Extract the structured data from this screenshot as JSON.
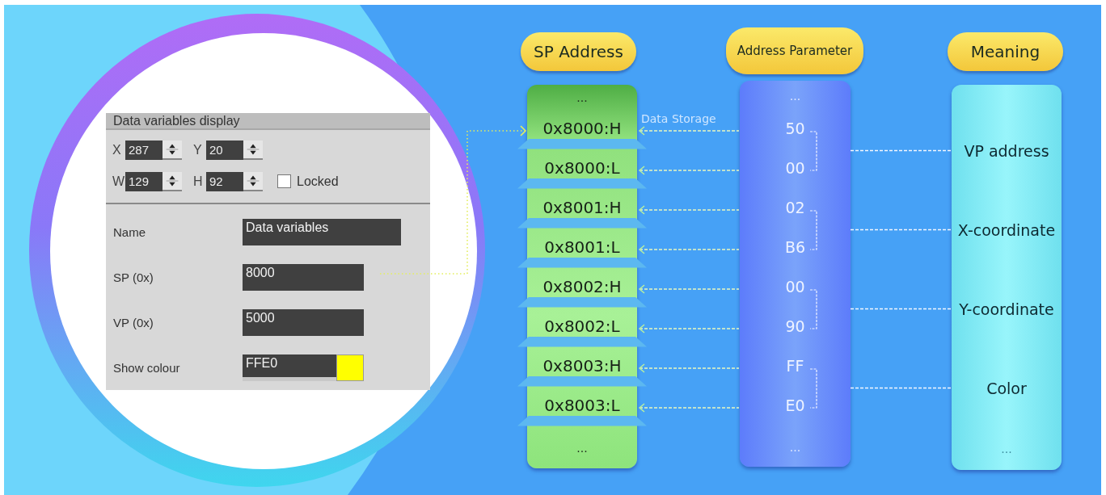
{
  "panel": {
    "title": "Data variables display",
    "geometry": [
      [
        {
          "label": "X",
          "value": "287"
        },
        {
          "label": "Y",
          "value": "20"
        }
      ],
      [
        {
          "label": "W",
          "value": "129"
        },
        {
          "label": "H",
          "value": "92"
        }
      ]
    ],
    "locked": {
      "label": "Locked",
      "checked": false
    },
    "properties": [
      {
        "kind": "text",
        "label": "Name",
        "value": "Data variables"
      },
      {
        "kind": "text",
        "label": "SP (0x)",
        "value": "8000"
      },
      {
        "kind": "text",
        "label": "VP (0x)",
        "value": "5000"
      },
      {
        "kind": "color",
        "label": "Show colour",
        "value": "FFE0",
        "color": "#ffff00"
      }
    ]
  },
  "diagram": {
    "columns": [
      {
        "title": "SP Address",
        "top": "...",
        "bottom": "..."
      },
      {
        "title": "Address Parameter",
        "top": "...",
        "bottom": "..."
      },
      {
        "title": "Meaning",
        "bottom": "..."
      }
    ],
    "link_label": "Data Storage",
    "rows": [
      {
        "address": "0x8000:H",
        "value": "50"
      },
      {
        "address": "0x8000:L",
        "value": "00"
      },
      {
        "address": "0x8001:H",
        "value": "02"
      },
      {
        "address": "0x8001:L",
        "value": "B6"
      },
      {
        "address": "0x8002:H",
        "value": "00"
      },
      {
        "address": "0x8002:L",
        "value": "90"
      },
      {
        "address": "0x8003:H",
        "value": "FF"
      },
      {
        "address": "0x8003:L",
        "value": "E0"
      }
    ],
    "meanings": [
      "VP address",
      "X-coordinate",
      "Y-coordinate",
      "Color"
    ]
  }
}
